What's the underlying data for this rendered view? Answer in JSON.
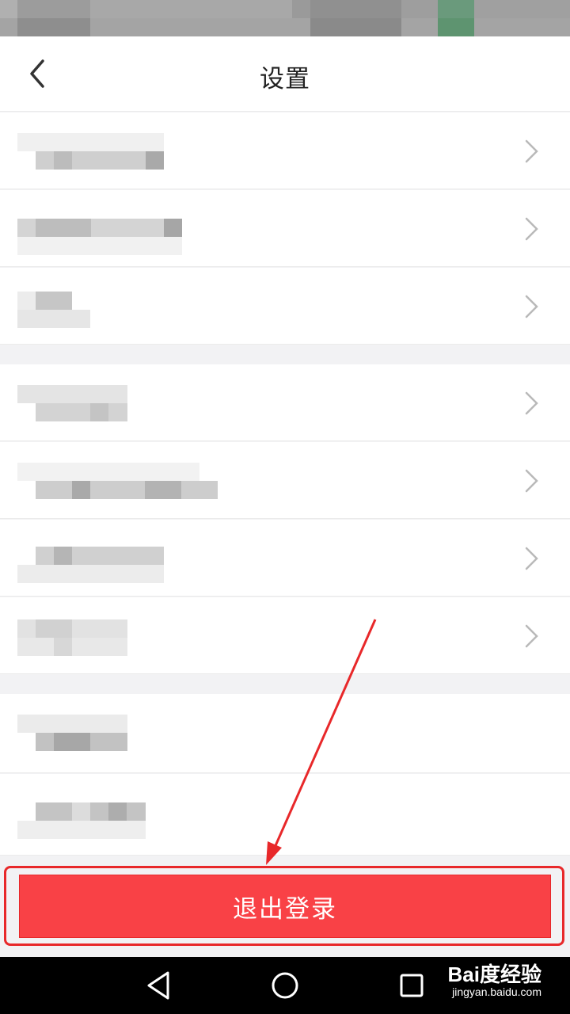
{
  "header": {
    "title": "设置",
    "back_icon": "chevron-left-icon"
  },
  "settings_items": [
    {
      "label": "",
      "has_chevron": true
    },
    {
      "label": "",
      "has_chevron": true
    },
    {
      "label": "",
      "has_chevron": true
    },
    {
      "label": "",
      "has_chevron": true
    },
    {
      "label": "",
      "has_chevron": true
    },
    {
      "label": "",
      "has_chevron": true
    },
    {
      "label": "",
      "has_chevron": true
    },
    {
      "label": "",
      "has_chevron": false
    },
    {
      "label": "",
      "has_chevron": false
    }
  ],
  "logout": {
    "label": "退出登录"
  },
  "nav_bar": {
    "icons": [
      "back-triangle-icon",
      "home-circle-icon",
      "recents-square-icon"
    ]
  },
  "watermark": {
    "logo": "Bai度经验",
    "url": "jingyan.baidu.com"
  },
  "colors": {
    "logout_button": "#f94146",
    "annotation_red": "#e8282a",
    "background": "#f2f2f4"
  }
}
